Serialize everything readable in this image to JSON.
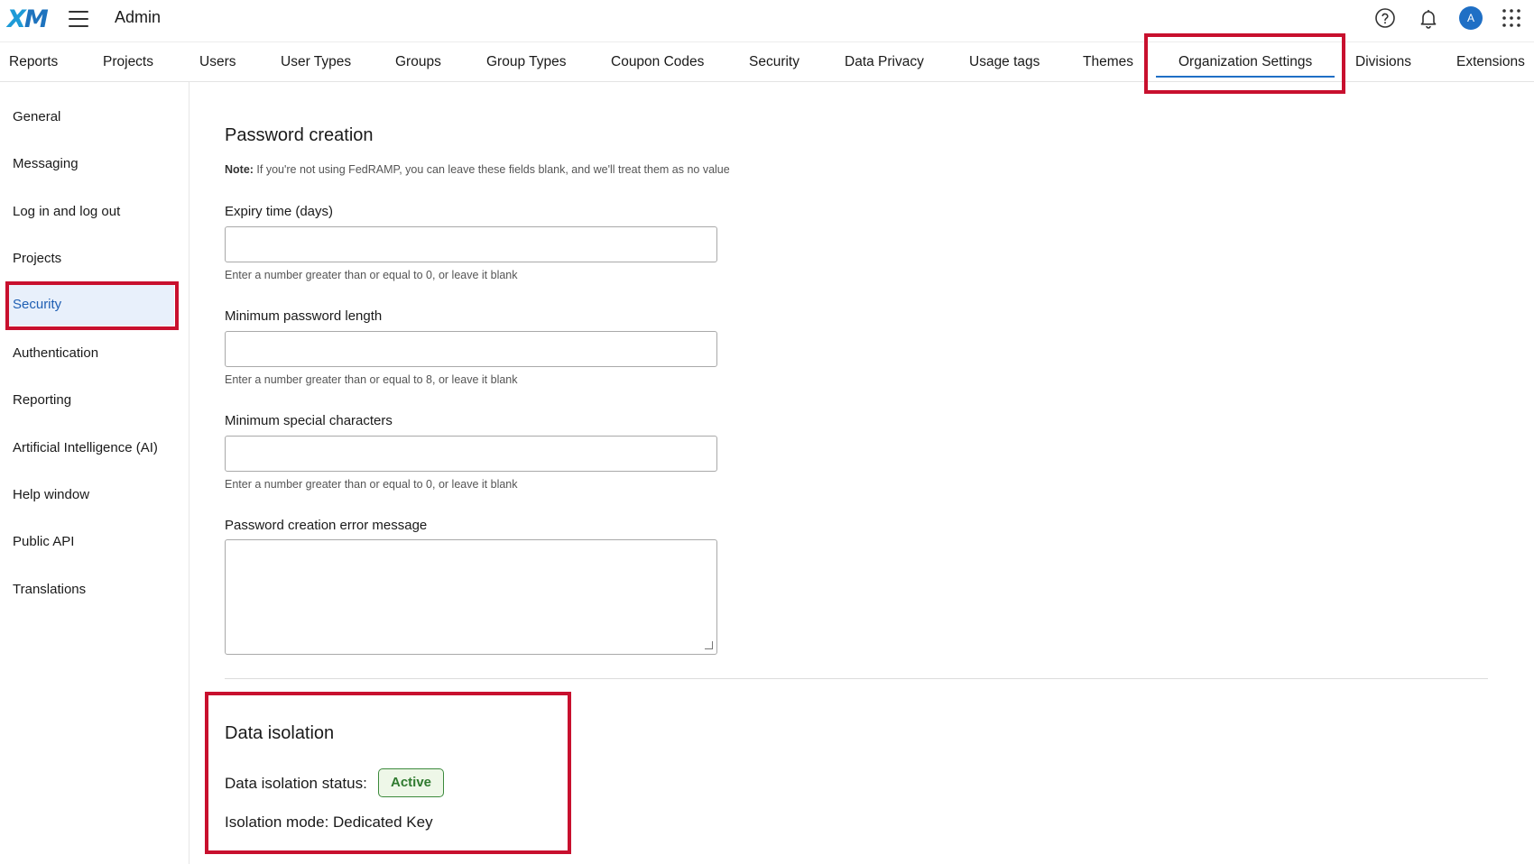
{
  "header": {
    "logo_x": "X",
    "logo_m": "M",
    "app_title": "Admin"
  },
  "tabs": [
    {
      "label": "Reports"
    },
    {
      "label": "Projects"
    },
    {
      "label": "Users"
    },
    {
      "label": "User Types"
    },
    {
      "label": "Groups"
    },
    {
      "label": "Group Types"
    },
    {
      "label": "Coupon Codes"
    },
    {
      "label": "Security"
    },
    {
      "label": "Data Privacy"
    },
    {
      "label": "Usage tags"
    },
    {
      "label": "Themes"
    },
    {
      "label": "Organization Settings",
      "active": true
    },
    {
      "label": "Divisions"
    },
    {
      "label": "Extensions"
    }
  ],
  "user": {
    "initial": "A"
  },
  "sidebar": {
    "items": [
      {
        "label": "General"
      },
      {
        "label": "Messaging"
      },
      {
        "label": "Log in and log out"
      },
      {
        "label": "Projects"
      },
      {
        "label": "Security",
        "active": true
      },
      {
        "label": "Authentication"
      },
      {
        "label": "Reporting"
      },
      {
        "label": "Artificial Intelligence (AI)"
      },
      {
        "label": "Help window"
      },
      {
        "label": "Public API"
      },
      {
        "label": "Translations"
      }
    ]
  },
  "password_creation": {
    "title": "Password creation",
    "note_label": "Note:",
    "note_text": " If you're not using FedRAMP, you can leave these fields blank, and we'll treat them as no value",
    "expiry": {
      "label": "Expiry time (days)",
      "value": "",
      "hint": "Enter a number greater than or equal to 0, or leave it blank"
    },
    "min_length": {
      "label": "Minimum password length",
      "value": "",
      "hint": "Enter a number greater than or equal to 8, or leave it blank"
    },
    "min_special": {
      "label": "Minimum special characters",
      "value": "",
      "hint": "Enter a number greater than or equal to 0, or leave it blank"
    },
    "error_message": {
      "label": "Password creation error message",
      "value": ""
    }
  },
  "data_isolation": {
    "title": "Data isolation",
    "status_label": "Data isolation status:",
    "status_value": "Active",
    "mode_text": "Isolation mode: Dedicated Key"
  },
  "colors": {
    "accent": "#1f6fc5",
    "highlight": "#c8102e",
    "active_badge": "#2f7a2f"
  }
}
